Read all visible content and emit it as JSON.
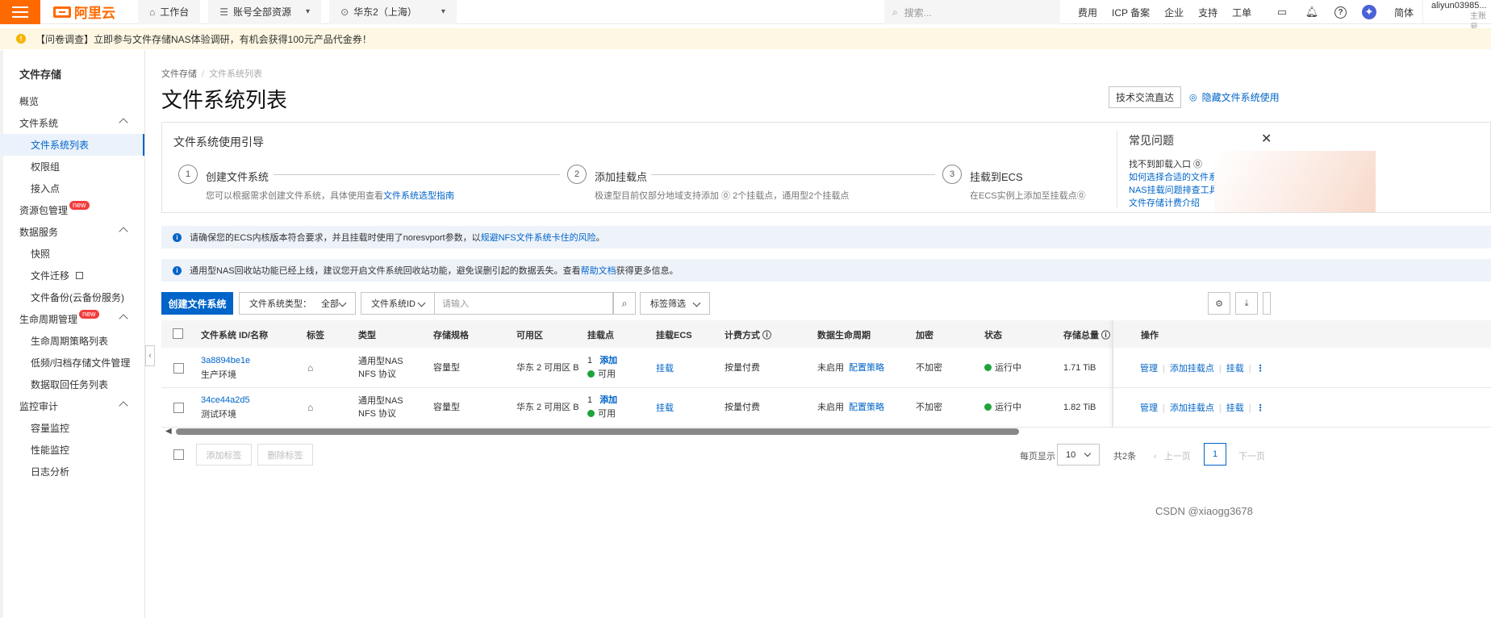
{
  "brand": {
    "logo_text": "阿里云",
    "accent": "#ff6a00",
    "primary": "#0064c8"
  },
  "topnav": {
    "workbench": "工作台",
    "resources": "账号全部资源",
    "region": "华东2（上海）",
    "search_placeholder": "搜索...",
    "links": [
      "费用",
      "ICP 备案",
      "企业",
      "支持",
      "工单"
    ],
    "lang": "简体",
    "user": "aliyun03985...",
    "user_sub": "主账号"
  },
  "notice": {
    "text": "【问卷调查】立即参与文件存储NAS体验调研，有机会获得100元产品代金券！"
  },
  "sidebar": {
    "title": "文件存储",
    "items": [
      {
        "label": "概览"
      },
      {
        "label": "文件系统"
      },
      {
        "label": "文件系统列表"
      },
      {
        "label": "权限组"
      },
      {
        "label": "接入点"
      },
      {
        "label": "资源包管理"
      },
      {
        "label": "数据服务"
      },
      {
        "label": "快照"
      },
      {
        "label": "文件迁移"
      },
      {
        "label": "文件备份(云备份服务)"
      },
      {
        "label": "生命周期管理"
      },
      {
        "label": "生命周期策略列表"
      },
      {
        "label": "低频/归档存储文件管理"
      },
      {
        "label": "数据取回任务列表"
      },
      {
        "label": "监控审计"
      },
      {
        "label": "容量监控"
      },
      {
        "label": "性能监控"
      },
      {
        "label": "日志分析"
      }
    ],
    "badge_new": "new"
  },
  "breadcrumb": {
    "root": "文件存储",
    "current": "文件系统列表"
  },
  "page": {
    "title": "文件系统列表",
    "tech_btn": "技术交流直达",
    "hide_guide": "隐藏文件系统使用"
  },
  "guide": {
    "title": "文件系统使用引导",
    "steps": [
      {
        "num": "1",
        "name": "创建文件系统",
        "desc": "您可以根据需求创建文件系统，具体使用查看",
        "link": "文件系统选型指南"
      },
      {
        "num": "2",
        "name": "添加挂载点",
        "desc": "极速型目前仅部分地域支持添加 ⓪ 2个挂载点，通用型2个挂载点"
      },
      {
        "num": "3",
        "name": "挂载到ECS",
        "desc": "在ECS实例上添加至挂载点⓪"
      }
    ],
    "faq_title": "常见问题",
    "faq": [
      "找不到卸载入口 ⓪",
      "如何选择合适的文件系统?",
      "NAS挂载问题排查工具",
      "文件存储计费介绍"
    ]
  },
  "alerts": [
    {
      "text": "请确保您的ECS内核版本符合要求，并且挂载时使用了noresvport参数，以",
      "link": "规避NFS文件系统卡住的风险",
      "tail": "。"
    },
    {
      "text": "通用型NAS回收站功能已经上线，建议您开启文件系统回收站功能，避免误删引起的数据丢失。查看",
      "link": "帮助文档",
      "tail": "获得更多信息。"
    }
  ],
  "toolbar": {
    "create": "创建文件系统",
    "type_label": "文件系统类型：",
    "type_value": "全部",
    "id_label": "文件系统ID",
    "search_placeholder": "请输入",
    "tag_filter": "标签筛选"
  },
  "table": {
    "headers": [
      "文件系统 ID/名称",
      "标签",
      "类型",
      "存储规格",
      "可用区",
      "挂载点",
      "挂载ECS",
      "计费方式 ⓘ",
      "数据生命周期",
      "加密",
      "状态",
      "存储总量 ⓘ",
      "操作"
    ],
    "rows": [
      {
        "id": "3a8894be1e",
        "name": "生产环境",
        "type1": "通用型NAS",
        "type2": "NFS 协议",
        "spec": "容量型",
        "zone": "华东 2 可用区 B",
        "mount_count": "1",
        "mount_add": "添加",
        "mount_status": "可用",
        "ecs": "挂载",
        "billing": "按量付费",
        "lifecycle": "未启用",
        "lifecycle_link": "配置策略",
        "encrypt": "不加密",
        "status": "运行中",
        "total": "1.71 TiB",
        "op_manage": "管理",
        "op_add_mount": "添加挂载点",
        "op_mount": "挂载"
      },
      {
        "id": "34ce44a2d5",
        "name": "测试环境",
        "type1": "通用型NAS",
        "type2": "NFS 协议",
        "spec": "容量型",
        "zone": "华东 2 可用区 B",
        "mount_count": "1",
        "mount_add": "添加",
        "mount_status": "可用",
        "ecs": "挂载",
        "billing": "按量付费",
        "lifecycle": "未启用",
        "lifecycle_link": "配置策略",
        "encrypt": "不加密",
        "status": "运行中",
        "total": "1.82 TiB",
        "op_manage": "管理",
        "op_add_mount": "添加挂载点",
        "op_mount": "挂载"
      }
    ]
  },
  "footer": {
    "add_tag": "添加标签",
    "remove_tag": "删除标签",
    "per_page_label": "每页显示",
    "per_page": "10",
    "total": "共2条",
    "prev": "上一页",
    "page": "1",
    "next": "下一页"
  },
  "watermark": "CSDN @xiaogg3678"
}
